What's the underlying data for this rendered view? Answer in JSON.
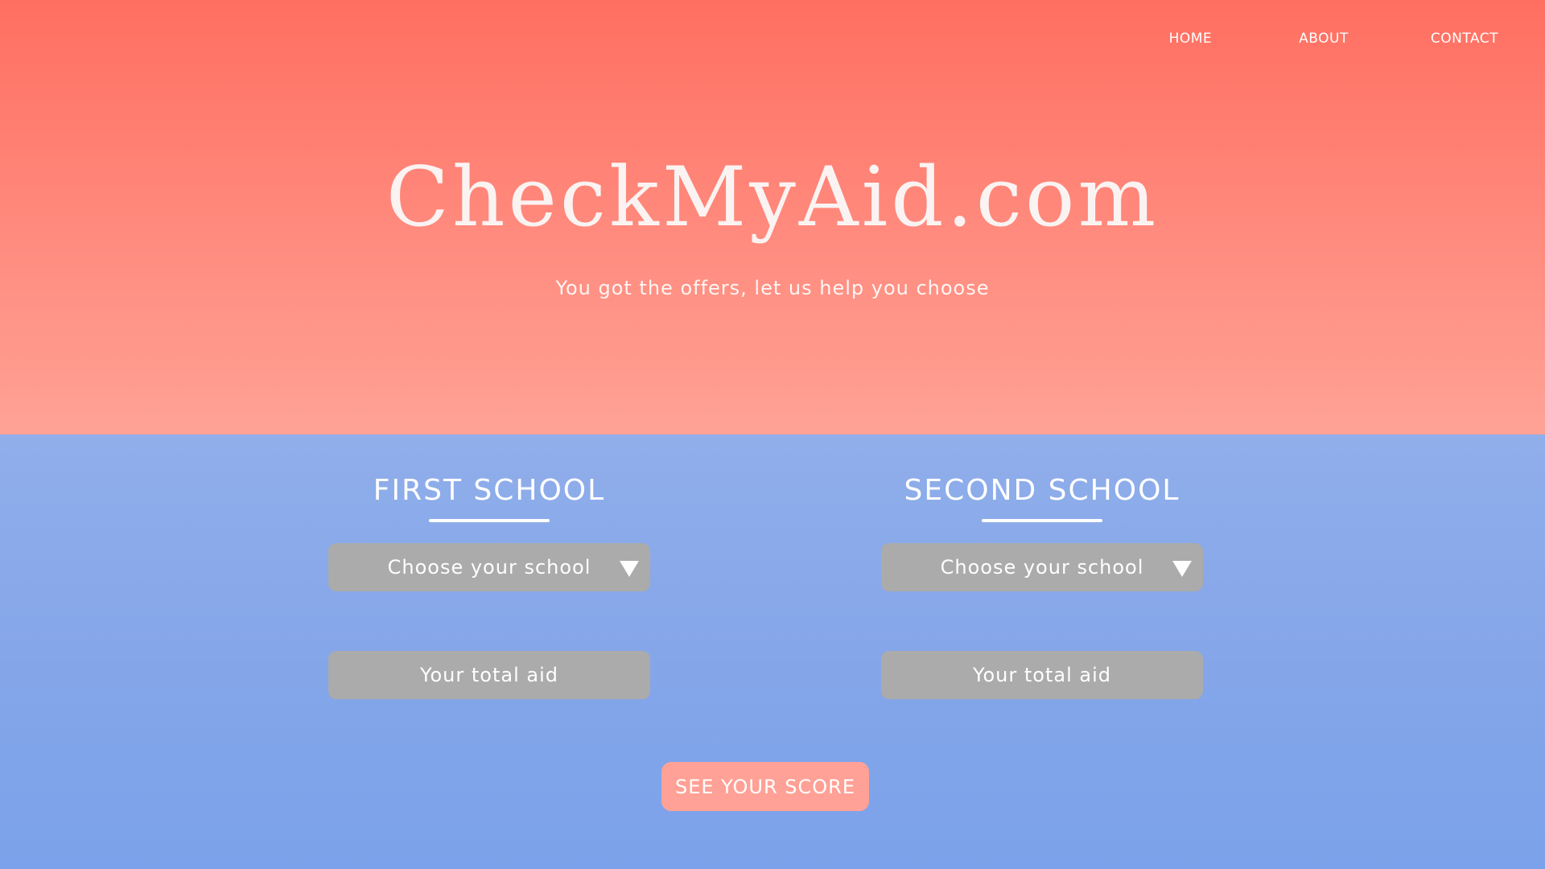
{
  "nav": {
    "home": "HOME",
    "about": "ABOUT",
    "contact": "CONTACT"
  },
  "hero": {
    "title": "CheckMyAid.com",
    "tagline": "You got the offers, let us help you choose"
  },
  "first_school": {
    "heading": "FIRST SCHOOL",
    "select_placeholder": "Choose your school",
    "aid_placeholder": "Your total aid"
  },
  "second_school": {
    "heading": "SECOND SCHOOL",
    "select_placeholder": "Choose your school",
    "aid_placeholder": "Your total aid"
  },
  "actions": {
    "score_label": "SEE YOUR SCORE"
  },
  "colors": {
    "hero_top": "#ff6f61",
    "hero_bottom": "#ffa296",
    "form_bg": "#85a6e9",
    "input_bg": "#ababab",
    "button_bg": "#ffa196",
    "text": "#ffffff"
  },
  "icons": {
    "dropdown": "chevron-down-icon"
  }
}
